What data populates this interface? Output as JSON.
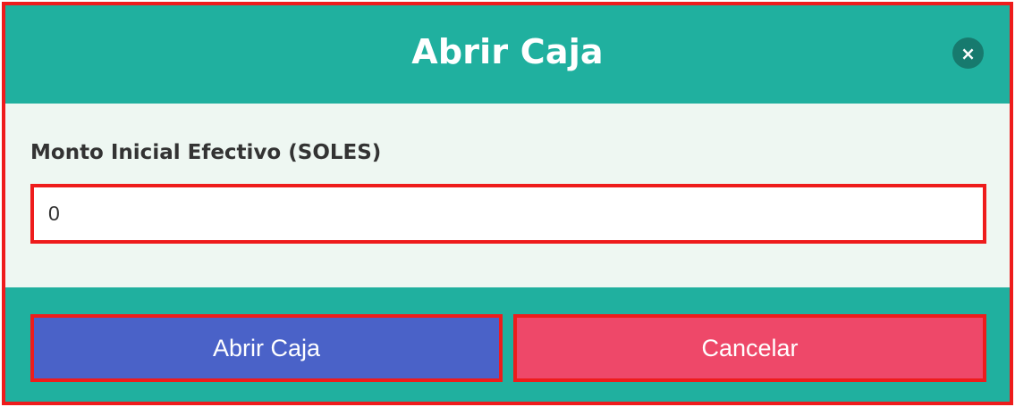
{
  "dialog": {
    "title": "Abrir Caja",
    "close_label": "×"
  },
  "form": {
    "amount_label": "Monto Inicial Efectivo (SOLES)",
    "amount_value": "0"
  },
  "footer": {
    "open_label": "Abrir Caja",
    "cancel_label": "Cancelar"
  },
  "colors": {
    "primary": "#20b09f",
    "open_button": "#4a62c8",
    "cancel_button": "#ee4869",
    "highlight": "#ee1c1c",
    "body_background": "#eef7f2"
  }
}
